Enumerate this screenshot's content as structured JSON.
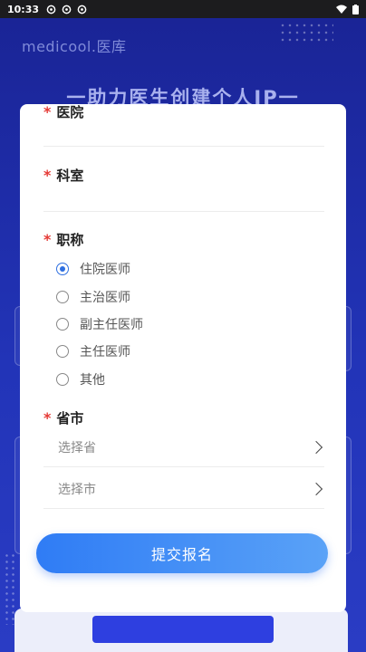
{
  "status_bar": {
    "time": "10:33"
  },
  "background": {
    "logo": "medicool.医库",
    "headline": "一助力医生创建个人IP一"
  },
  "form": {
    "hospital": {
      "label": "医院"
    },
    "department": {
      "label": "科室"
    },
    "title": {
      "label": "职称",
      "options": [
        "住院医师",
        "主治医师",
        "副主任医师",
        "主任医师",
        "其他"
      ],
      "selected_index": 0
    },
    "region": {
      "label": "省市",
      "province_placeholder": "选择省",
      "city_placeholder": "选择市"
    },
    "submit_label": "提交报名"
  },
  "colors": {
    "accent": "#2e6fe0",
    "required": "#e53935",
    "background": "#1b2aa0"
  }
}
